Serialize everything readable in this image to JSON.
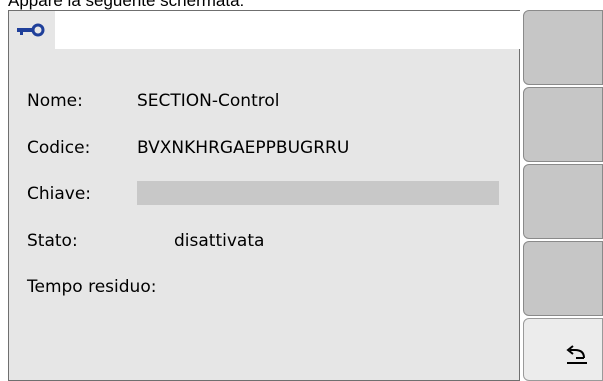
{
  "caption": "Appare la seguente schermata:",
  "tab": {
    "icon": "key-icon"
  },
  "fields": {
    "nome_label": "Nome:",
    "nome_value": "SECTION-Control",
    "codice_label": "Codice:",
    "codice_value": "BVXNKHRGAEPPBUGRRU",
    "chiave_label": "Chiave:",
    "chiave_value": "",
    "stato_label": "Stato:",
    "stato_value": "disattivata",
    "tempo_label": "Tempo residuo:",
    "tempo_value": ""
  },
  "softkeys": [
    {
      "name": "softkey-1"
    },
    {
      "name": "softkey-2"
    },
    {
      "name": "softkey-3"
    },
    {
      "name": "softkey-4"
    },
    {
      "name": "back-button",
      "icon": "return-arrow-icon"
    }
  ],
  "colors": {
    "panel": "#e6e6e6",
    "softkey": "#c6c6c6",
    "field": "#c8c8c8"
  }
}
